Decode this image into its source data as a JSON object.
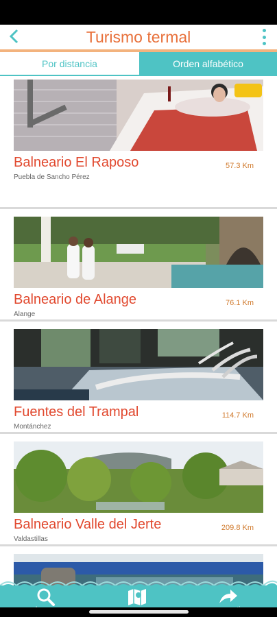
{
  "header": {
    "title": "Turismo termal"
  },
  "tabs": [
    {
      "label": "Por distancia"
    },
    {
      "label": "Orden alfabético"
    }
  ],
  "items": [
    {
      "name": "Balneario El Raposo",
      "place": "Puebla de Sancho Pérez",
      "distance": "57.3 Km"
    },
    {
      "name": "Balneario de Alange",
      "place": "Alange",
      "distance": "76.1 Km"
    },
    {
      "name": "Fuentes del Trampal",
      "place": "Montánchez",
      "distance": "114.7 Km"
    },
    {
      "name": "Balneario Valle del Jerte",
      "place": "Valdastillas",
      "distance": "209.8 Km"
    }
  ],
  "footer": {
    "search_label": "buscar",
    "map_label": "mapa",
    "share_label": "compartir"
  },
  "colors": {
    "accent": "#4ec3c4",
    "title": "#e8703a",
    "item_name": "#e1492f"
  }
}
